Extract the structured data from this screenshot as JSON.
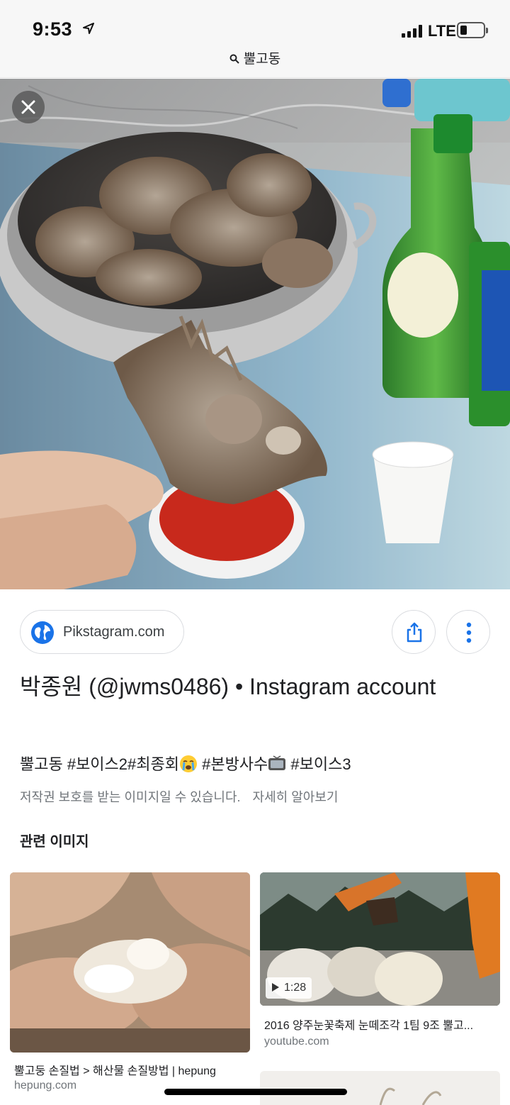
{
  "status_bar": {
    "time": "9:53",
    "network": "LTE"
  },
  "search_query": "뿔고동",
  "detail": {
    "source": "Pikstagram.com",
    "title": "박종원 (@jwms0486) • Instagram account",
    "caption": {
      "part1": "뿔고동 #보이스2#최종회",
      "part2": " #본방사수",
      "part3": " #보이스3"
    },
    "copyright_notice": "저작권 보호를 받는 이미지일 수 있습니다.",
    "learn_more": "자세히 알아보기"
  },
  "related": {
    "heading": "관련 이미지",
    "items": [
      {
        "title": "뿔고둥 손질법 > 해산물 손질방법 | hepung",
        "domain": "hepung.com"
      },
      {
        "title": "2016 양주눈꽃축제 눈떼조각 1팀 9조 뿔고...",
        "domain": "youtube.com",
        "duration": "1:28"
      }
    ]
  },
  "icons": {
    "close": "close-icon",
    "globe": "globe-icon",
    "share": "share-icon",
    "more": "more-vert-icon",
    "search": "search-icon",
    "play": "play-icon"
  },
  "colors": {
    "accent_blue": "#1a73e8",
    "text_primary": "#202124",
    "text_secondary": "#70757a"
  }
}
